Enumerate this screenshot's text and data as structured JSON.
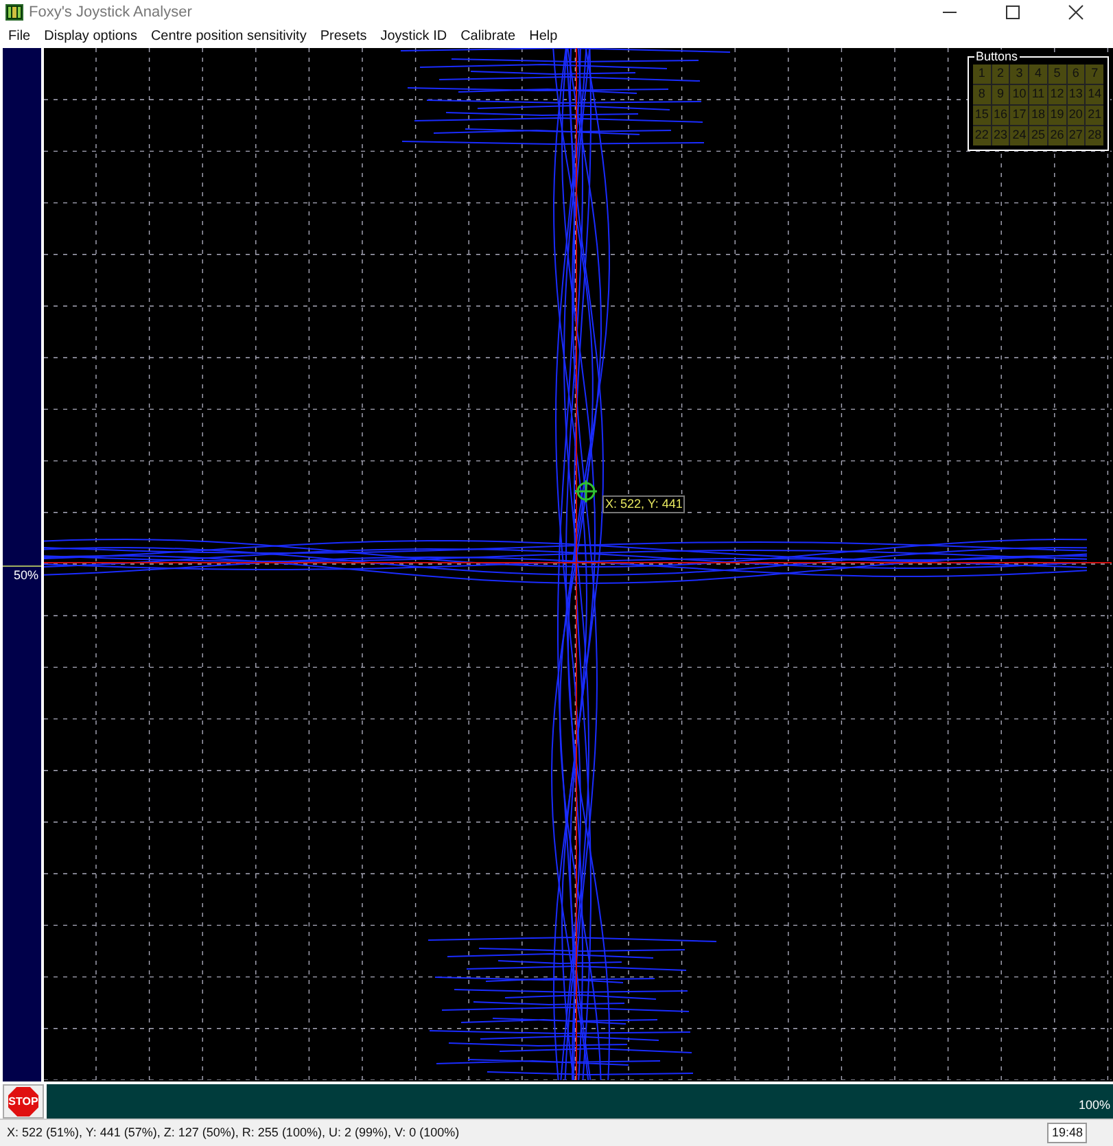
{
  "window": {
    "title": "Foxy's Joystick Analyser"
  },
  "menu": [
    "File",
    "Display options",
    "Centre position sensitivity",
    "Presets",
    "Joystick ID",
    "Calibrate",
    "Help"
  ],
  "left_gauge": {
    "reading": "50%",
    "level": 0.5
  },
  "plot": {
    "cursor_label": "X: 522, Y: 441"
  },
  "buttons_panel": {
    "title": "Buttons",
    "buttons": [
      {
        "label": "1",
        "pressed": false
      },
      {
        "label": "2",
        "pressed": false
      },
      {
        "label": "3",
        "pressed": false
      },
      {
        "label": "4",
        "pressed": false
      },
      {
        "label": "5",
        "pressed": false
      },
      {
        "label": "6",
        "pressed": false
      },
      {
        "label": "7",
        "pressed": false
      },
      {
        "label": "8",
        "pressed": false
      },
      {
        "label": "9",
        "pressed": false
      },
      {
        "label": "10",
        "pressed": false
      },
      {
        "label": "11",
        "pressed": false
      },
      {
        "label": "12",
        "pressed": false
      },
      {
        "label": "13",
        "pressed": false
      },
      {
        "label": "14",
        "pressed": false
      },
      {
        "label": "15",
        "pressed": false
      },
      {
        "label": "16",
        "pressed": false
      },
      {
        "label": "17",
        "pressed": false
      },
      {
        "label": "18",
        "pressed": false
      },
      {
        "label": "19",
        "pressed": false
      },
      {
        "label": "20",
        "pressed": false
      },
      {
        "label": "21",
        "pressed": false
      },
      {
        "label": "22",
        "pressed": false
      },
      {
        "label": "23",
        "pressed": false
      },
      {
        "label": "24",
        "pressed": false
      },
      {
        "label": "25",
        "pressed": false
      },
      {
        "label": "26",
        "pressed": false
      },
      {
        "label": "27",
        "pressed": false
      },
      {
        "label": "28",
        "pressed": false
      }
    ]
  },
  "stop_button": {
    "label": "STOP"
  },
  "bottom_gauge": {
    "reading": "100%",
    "level": 1
  },
  "status_bar": {
    "text": "X: 522 (51%), Y: 441 (57%), Z: 127 (50%), R: 255 (100%), U: 2 (99%), V: 0 (100%)",
    "time": "19:48"
  }
}
